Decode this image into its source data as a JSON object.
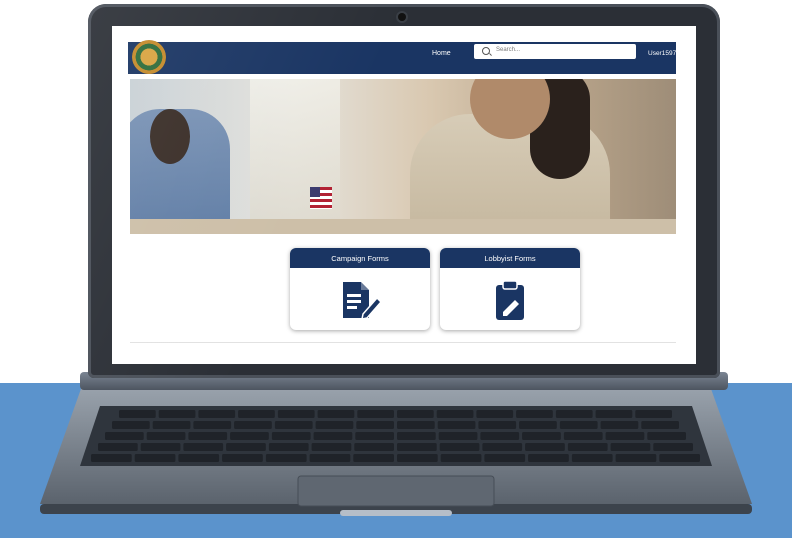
{
  "header": {
    "nav_home": "Home",
    "search_placeholder": "Search...",
    "user_label": "User1597"
  },
  "cards": [
    {
      "title": "Campaign Forms",
      "icon": "document-edit-icon"
    },
    {
      "title": "Lobbyist Forms",
      "icon": "clipboard-edit-icon"
    }
  ],
  "colors": {
    "brand_navy": "#1a3563",
    "background_blue": "#5b93cc"
  }
}
